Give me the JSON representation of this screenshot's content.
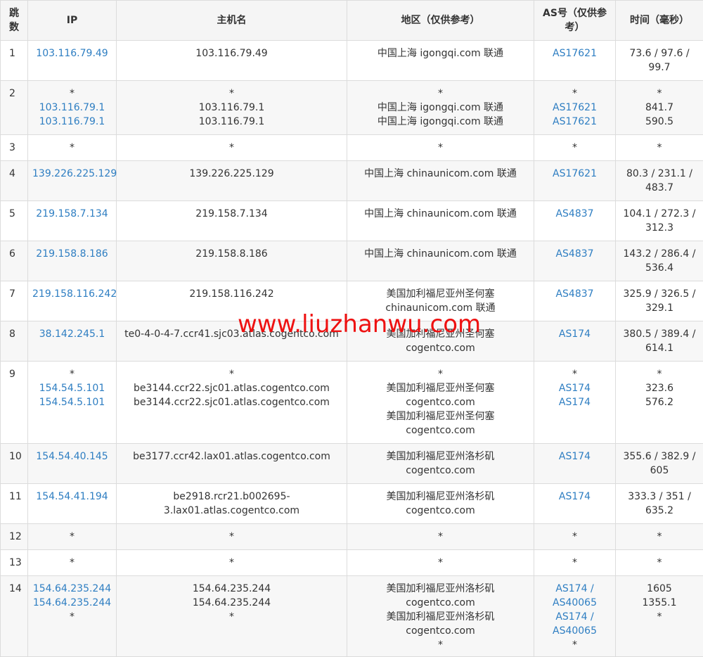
{
  "headers": {
    "hop": "跳数",
    "ip": "IP",
    "host": "主机名",
    "region": "地区（仅供参考）",
    "as": "AS号（仅供参考）",
    "time": "时间（毫秒）"
  },
  "rows": [
    {
      "hop": "1",
      "ip": [
        "103.116.79.49"
      ],
      "host": [
        "103.116.79.49"
      ],
      "region": [
        "中国上海 igongqi.com 联通"
      ],
      "as": [
        "AS17621"
      ],
      "time": [
        "73.6 / 97.6 /",
        "99.7"
      ]
    },
    {
      "hop": "2",
      "ip": [
        "*",
        "103.116.79.1",
        "103.116.79.1"
      ],
      "host": [
        "*",
        "103.116.79.1",
        "103.116.79.1"
      ],
      "region": [
        "*",
        "中国上海 igongqi.com 联通",
        "中国上海 igongqi.com 联通"
      ],
      "as": [
        "*",
        "AS17621",
        "AS17621"
      ],
      "time": [
        "*",
        "841.7",
        "590.5"
      ]
    },
    {
      "hop": "3",
      "ip": [
        "*"
      ],
      "host": [
        "*"
      ],
      "region": [
        "*"
      ],
      "as": [
        "*"
      ],
      "time": [
        "*"
      ]
    },
    {
      "hop": "4",
      "ip": [
        "139.226.225.129"
      ],
      "host": [
        "139.226.225.129"
      ],
      "region": [
        "中国上海 chinaunicom.com 联通"
      ],
      "as": [
        "AS17621"
      ],
      "time": [
        "80.3 / 231.1 /",
        "483.7"
      ]
    },
    {
      "hop": "5",
      "ip": [
        "219.158.7.134"
      ],
      "host": [
        "219.158.7.134"
      ],
      "region": [
        "中国上海 chinaunicom.com 联通"
      ],
      "as": [
        "AS4837"
      ],
      "time": [
        "104.1 / 272.3 /",
        "312.3"
      ]
    },
    {
      "hop": "6",
      "ip": [
        "219.158.8.186"
      ],
      "host": [
        "219.158.8.186"
      ],
      "region": [
        "中国上海 chinaunicom.com 联通"
      ],
      "as": [
        "AS4837"
      ],
      "time": [
        "143.2 / 286.4 /",
        "536.4"
      ]
    },
    {
      "hop": "7",
      "ip": [
        "219.158.116.242"
      ],
      "host": [
        "219.158.116.242"
      ],
      "region": [
        "美国加利福尼亚州圣何塞",
        "chinaunicom.com 联通"
      ],
      "as": [
        "AS4837"
      ],
      "time": [
        "325.9 / 326.5 /",
        "329.1"
      ]
    },
    {
      "hop": "8",
      "ip": [
        "38.142.245.1"
      ],
      "host": [
        "te0-4-0-4-7.ccr41.sjc03.atlas.cogentco.com"
      ],
      "region": [
        "美国加利福尼亚州圣何塞",
        "cogentco.com"
      ],
      "as": [
        "AS174"
      ],
      "time": [
        "380.5 / 389.4 /",
        "614.1"
      ]
    },
    {
      "hop": "9",
      "ip": [
        "*",
        "154.54.5.101",
        "154.54.5.101"
      ],
      "host": [
        "*",
        "be3144.ccr22.sjc01.atlas.cogentco.com",
        "be3144.ccr22.sjc01.atlas.cogentco.com"
      ],
      "region": [
        "*",
        "美国加利福尼亚州圣何塞",
        "cogentco.com",
        "美国加利福尼亚州圣何塞",
        "cogentco.com"
      ],
      "as": [
        "*",
        "AS174",
        "AS174"
      ],
      "time": [
        "*",
        "323.6",
        "576.2"
      ]
    },
    {
      "hop": "10",
      "ip": [
        "154.54.40.145"
      ],
      "host": [
        "be3177.ccr42.lax01.atlas.cogentco.com"
      ],
      "region": [
        "美国加利福尼亚州洛杉矶",
        "cogentco.com"
      ],
      "as": [
        "AS174"
      ],
      "time": [
        "355.6 / 382.9 /",
        "605"
      ]
    },
    {
      "hop": "11",
      "ip": [
        "154.54.41.194"
      ],
      "host": [
        "be2918.rcr21.b002695-",
        "3.lax01.atlas.cogentco.com"
      ],
      "region": [
        "美国加利福尼亚州洛杉矶",
        "cogentco.com"
      ],
      "as": [
        "AS174"
      ],
      "time": [
        "333.3 / 351 /",
        "635.2"
      ]
    },
    {
      "hop": "12",
      "ip": [
        "*"
      ],
      "host": [
        "*"
      ],
      "region": [
        "*"
      ],
      "as": [
        "*"
      ],
      "time": [
        "*"
      ]
    },
    {
      "hop": "13",
      "ip": [
        "*"
      ],
      "host": [
        "*"
      ],
      "region": [
        "*"
      ],
      "as": [
        "*"
      ],
      "time": [
        "*"
      ]
    },
    {
      "hop": "14",
      "ip": [
        "154.64.235.244",
        "154.64.235.244",
        "*"
      ],
      "host": [
        "154.64.235.244",
        "154.64.235.244",
        "*"
      ],
      "region": [
        "美国加利福尼亚州洛杉矶",
        "cogentco.com",
        "美国加利福尼亚州洛杉矶",
        "cogentco.com",
        "*"
      ],
      "as": [
        "AS174 /",
        "AS40065",
        "AS174 /",
        "AS40065",
        "*"
      ],
      "time": [
        "1605",
        "1355.1",
        "*"
      ]
    }
  ],
  "watermark": "www.liuzhanwu.com",
  "colors": {
    "link": "#2e7ec2",
    "header_bg": "#f5f5f5",
    "stripe_bg": "#f7f7f7",
    "watermark": "#ee1111"
  }
}
